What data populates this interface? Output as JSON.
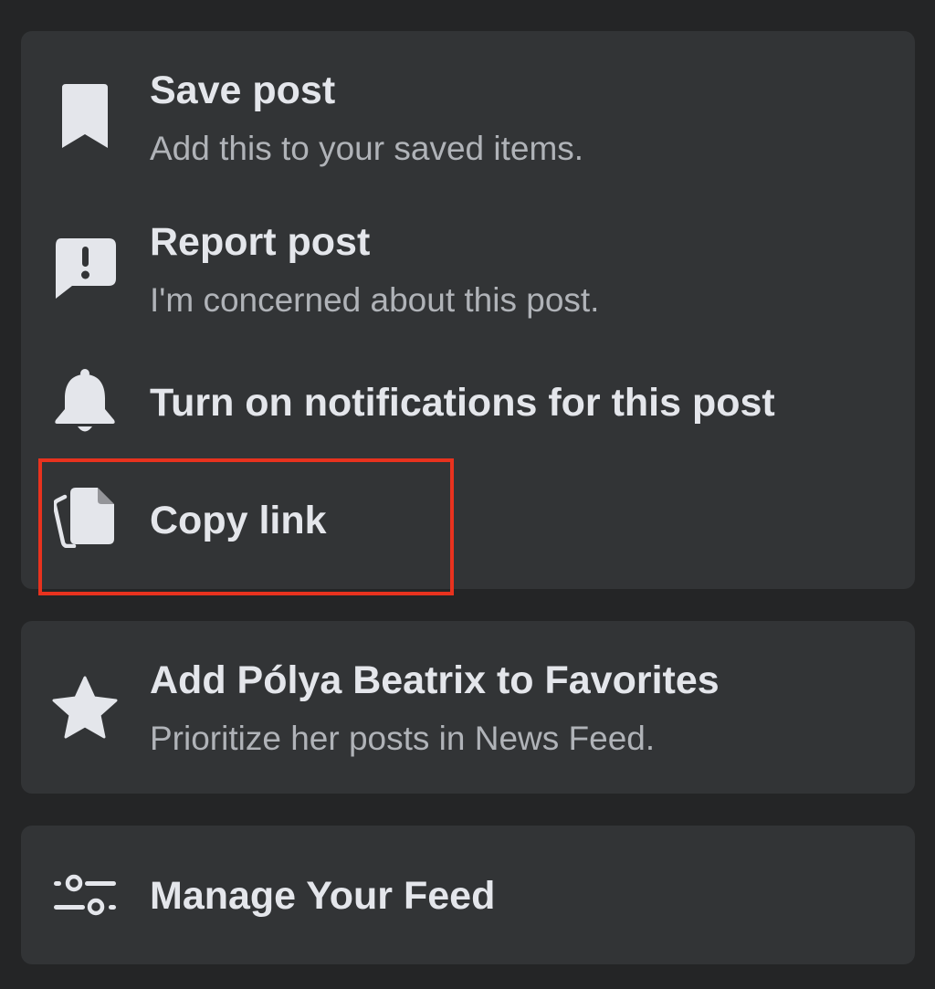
{
  "menu": {
    "group1": {
      "save_post": {
        "icon": "bookmark-icon",
        "title": "Save post",
        "subtitle": "Add this to your saved items."
      },
      "report_post": {
        "icon": "report-icon",
        "title": "Report post",
        "subtitle": "I'm concerned about this post."
      },
      "notifications": {
        "icon": "bell-icon",
        "title": "Turn on notifications for this post"
      },
      "copy_link": {
        "icon": "copy-icon",
        "title": "Copy link"
      }
    },
    "group2": {
      "favorites": {
        "icon": "star-icon",
        "title": "Add Pólya Beatrix to Favorites",
        "subtitle": "Prioritize her posts in News Feed."
      }
    },
    "group3": {
      "manage_feed": {
        "icon": "sliders-icon",
        "title": "Manage Your Feed"
      }
    }
  },
  "colors": {
    "background": "#242526",
    "card": "#323436",
    "title_text": "#e4e6eb",
    "subtitle_text": "#b0b3b8",
    "icon": "#e4e6eb",
    "highlight": "#e8321e"
  }
}
